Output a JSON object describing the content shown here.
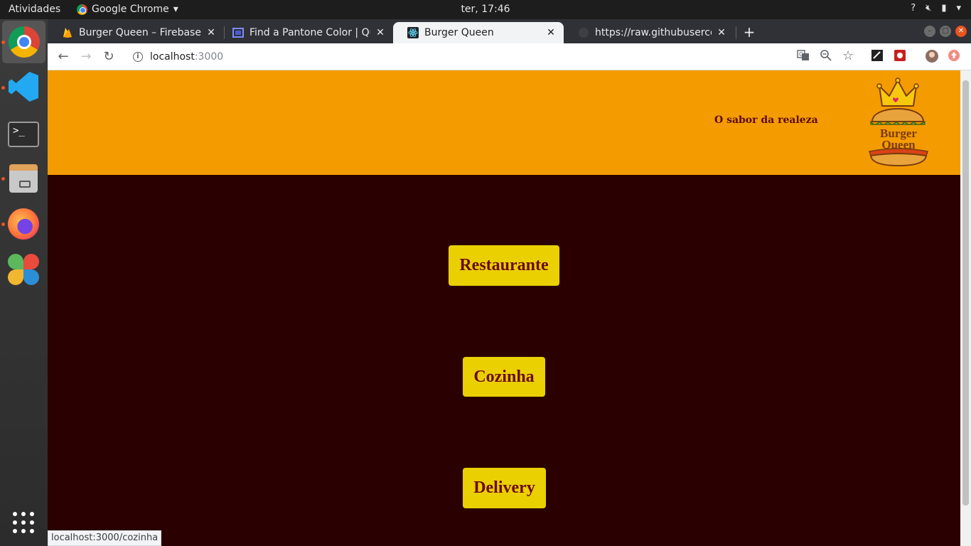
{
  "system": {
    "activities_label": "Atividades",
    "app_name": "Google Chrome",
    "clock": "ter, 17:46"
  },
  "browser": {
    "tabs": [
      {
        "title": "Burger Queen – Firebase c",
        "favicon": "firebase-icon",
        "active": false
      },
      {
        "title": "Find a Pantone Color | Qu",
        "favicon": "pantone-icon",
        "active": false
      },
      {
        "title": "Burger Queen",
        "favicon": "react-icon",
        "active": true
      },
      {
        "title": "https://raw.githubuserco",
        "favicon": "github-icon",
        "active": false
      }
    ],
    "address_host": "localhost",
    "address_port": ":3000",
    "status_url": "localhost:3000/cozinha"
  },
  "page": {
    "slogan": "O sabor da realeza",
    "logo_text_line1": "Burger",
    "logo_text_line2": "Queen",
    "buttons": [
      {
        "label": "Restaurante"
      },
      {
        "label": "Cozinha"
      },
      {
        "label": "Delivery"
      }
    ],
    "colors": {
      "header_bg": "#f49b00",
      "page_bg": "#2a0000",
      "button_bg": "#ead000",
      "button_text": "#6b0b0b"
    }
  }
}
